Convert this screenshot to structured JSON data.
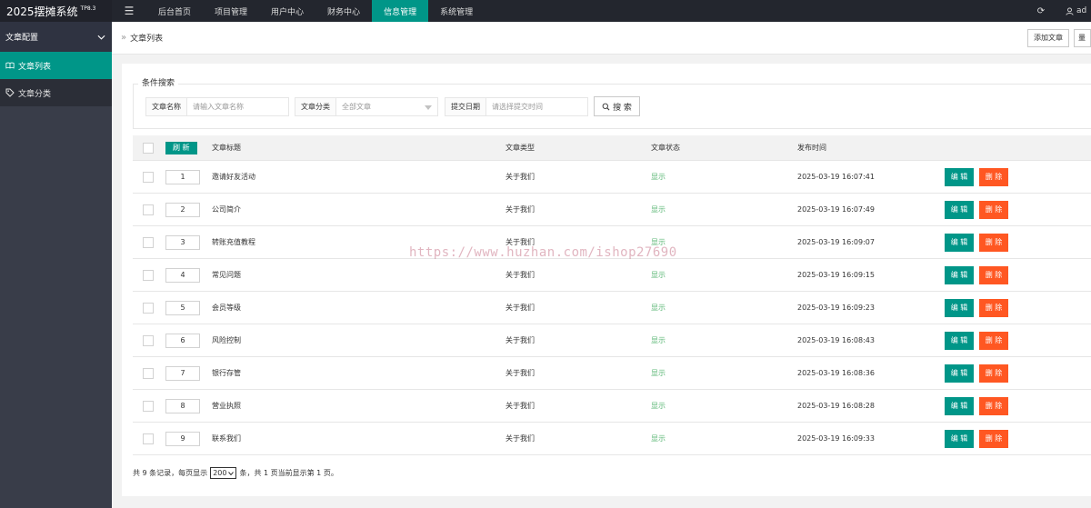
{
  "app": {
    "title": "2025摆摊系统",
    "version": "TP8.3"
  },
  "nav": {
    "toggle_icon": "☰",
    "items": [
      {
        "label": "后台首页",
        "active": false
      },
      {
        "label": "项目管理",
        "active": false
      },
      {
        "label": "用户中心",
        "active": false
      },
      {
        "label": "财务中心",
        "active": false
      },
      {
        "label": "信息管理",
        "active": true
      },
      {
        "label": "系统管理",
        "active": false
      }
    ],
    "refresh_icon": "⟳",
    "user_label": "ad"
  },
  "sidebar": {
    "group_label": "文章配置",
    "items": [
      {
        "label": "文章列表",
        "icon": "book-icon",
        "active": true
      },
      {
        "label": "文章分类",
        "icon": "tag-icon",
        "active": false
      }
    ]
  },
  "breadcrumb": {
    "separator": "»",
    "current": "文章列表",
    "add_button": "添加文章",
    "extra_button": "量"
  },
  "search": {
    "legend": "条件搜索",
    "name_label": "文章名称",
    "name_placeholder": "请输入文章名称",
    "category_label": "文章分类",
    "category_value": "全部文章",
    "date_label": "提交日期",
    "date_placeholder": "请选择提交时间",
    "search_button": "搜 索"
  },
  "table": {
    "refresh_button": "刷 新",
    "headers": {
      "title": "文章标题",
      "type": "文章类型",
      "status": "文章状态",
      "time": "发布时间"
    },
    "edit_label": "编 辑",
    "delete_label": "删 除",
    "rows": [
      {
        "order": "1",
        "title": "邀请好友活动",
        "type": "关于我们",
        "status": "显示",
        "time": "2025-03-19 16:07:41"
      },
      {
        "order": "2",
        "title": "公司简介",
        "type": "关于我们",
        "status": "显示",
        "time": "2025-03-19 16:07:49"
      },
      {
        "order": "3",
        "title": "转账充值教程",
        "type": "关于我们",
        "status": "显示",
        "time": "2025-03-19 16:09:07"
      },
      {
        "order": "4",
        "title": "常见问题",
        "type": "关于我们",
        "status": "显示",
        "time": "2025-03-19 16:09:15"
      },
      {
        "order": "5",
        "title": "会员等级",
        "type": "关于我们",
        "status": "显示",
        "time": "2025-03-19 16:09:23"
      },
      {
        "order": "6",
        "title": "风险控制",
        "type": "关于我们",
        "status": "显示",
        "time": "2025-03-19 16:08:43"
      },
      {
        "order": "7",
        "title": "银行存管",
        "type": "关于我们",
        "status": "显示",
        "time": "2025-03-19 16:08:36"
      },
      {
        "order": "8",
        "title": "营业执照",
        "type": "关于我们",
        "status": "显示",
        "time": "2025-03-19 16:08:28"
      },
      {
        "order": "9",
        "title": "联系我们",
        "type": "关于我们",
        "status": "显示",
        "time": "2025-03-19 16:09:33"
      }
    ]
  },
  "footer": {
    "prefix": "共 9 条记录，每页显示",
    "page_size": "200",
    "suffix": "条，共 1 页当前显示第 1 页。"
  },
  "watermark": "https://www.huzhan.com/ishop27690",
  "colors": {
    "accent": "#009688",
    "danger": "#ff5722",
    "topbar": "#23262e",
    "sidebar": "#393d49",
    "status_green": "#5fb878"
  }
}
